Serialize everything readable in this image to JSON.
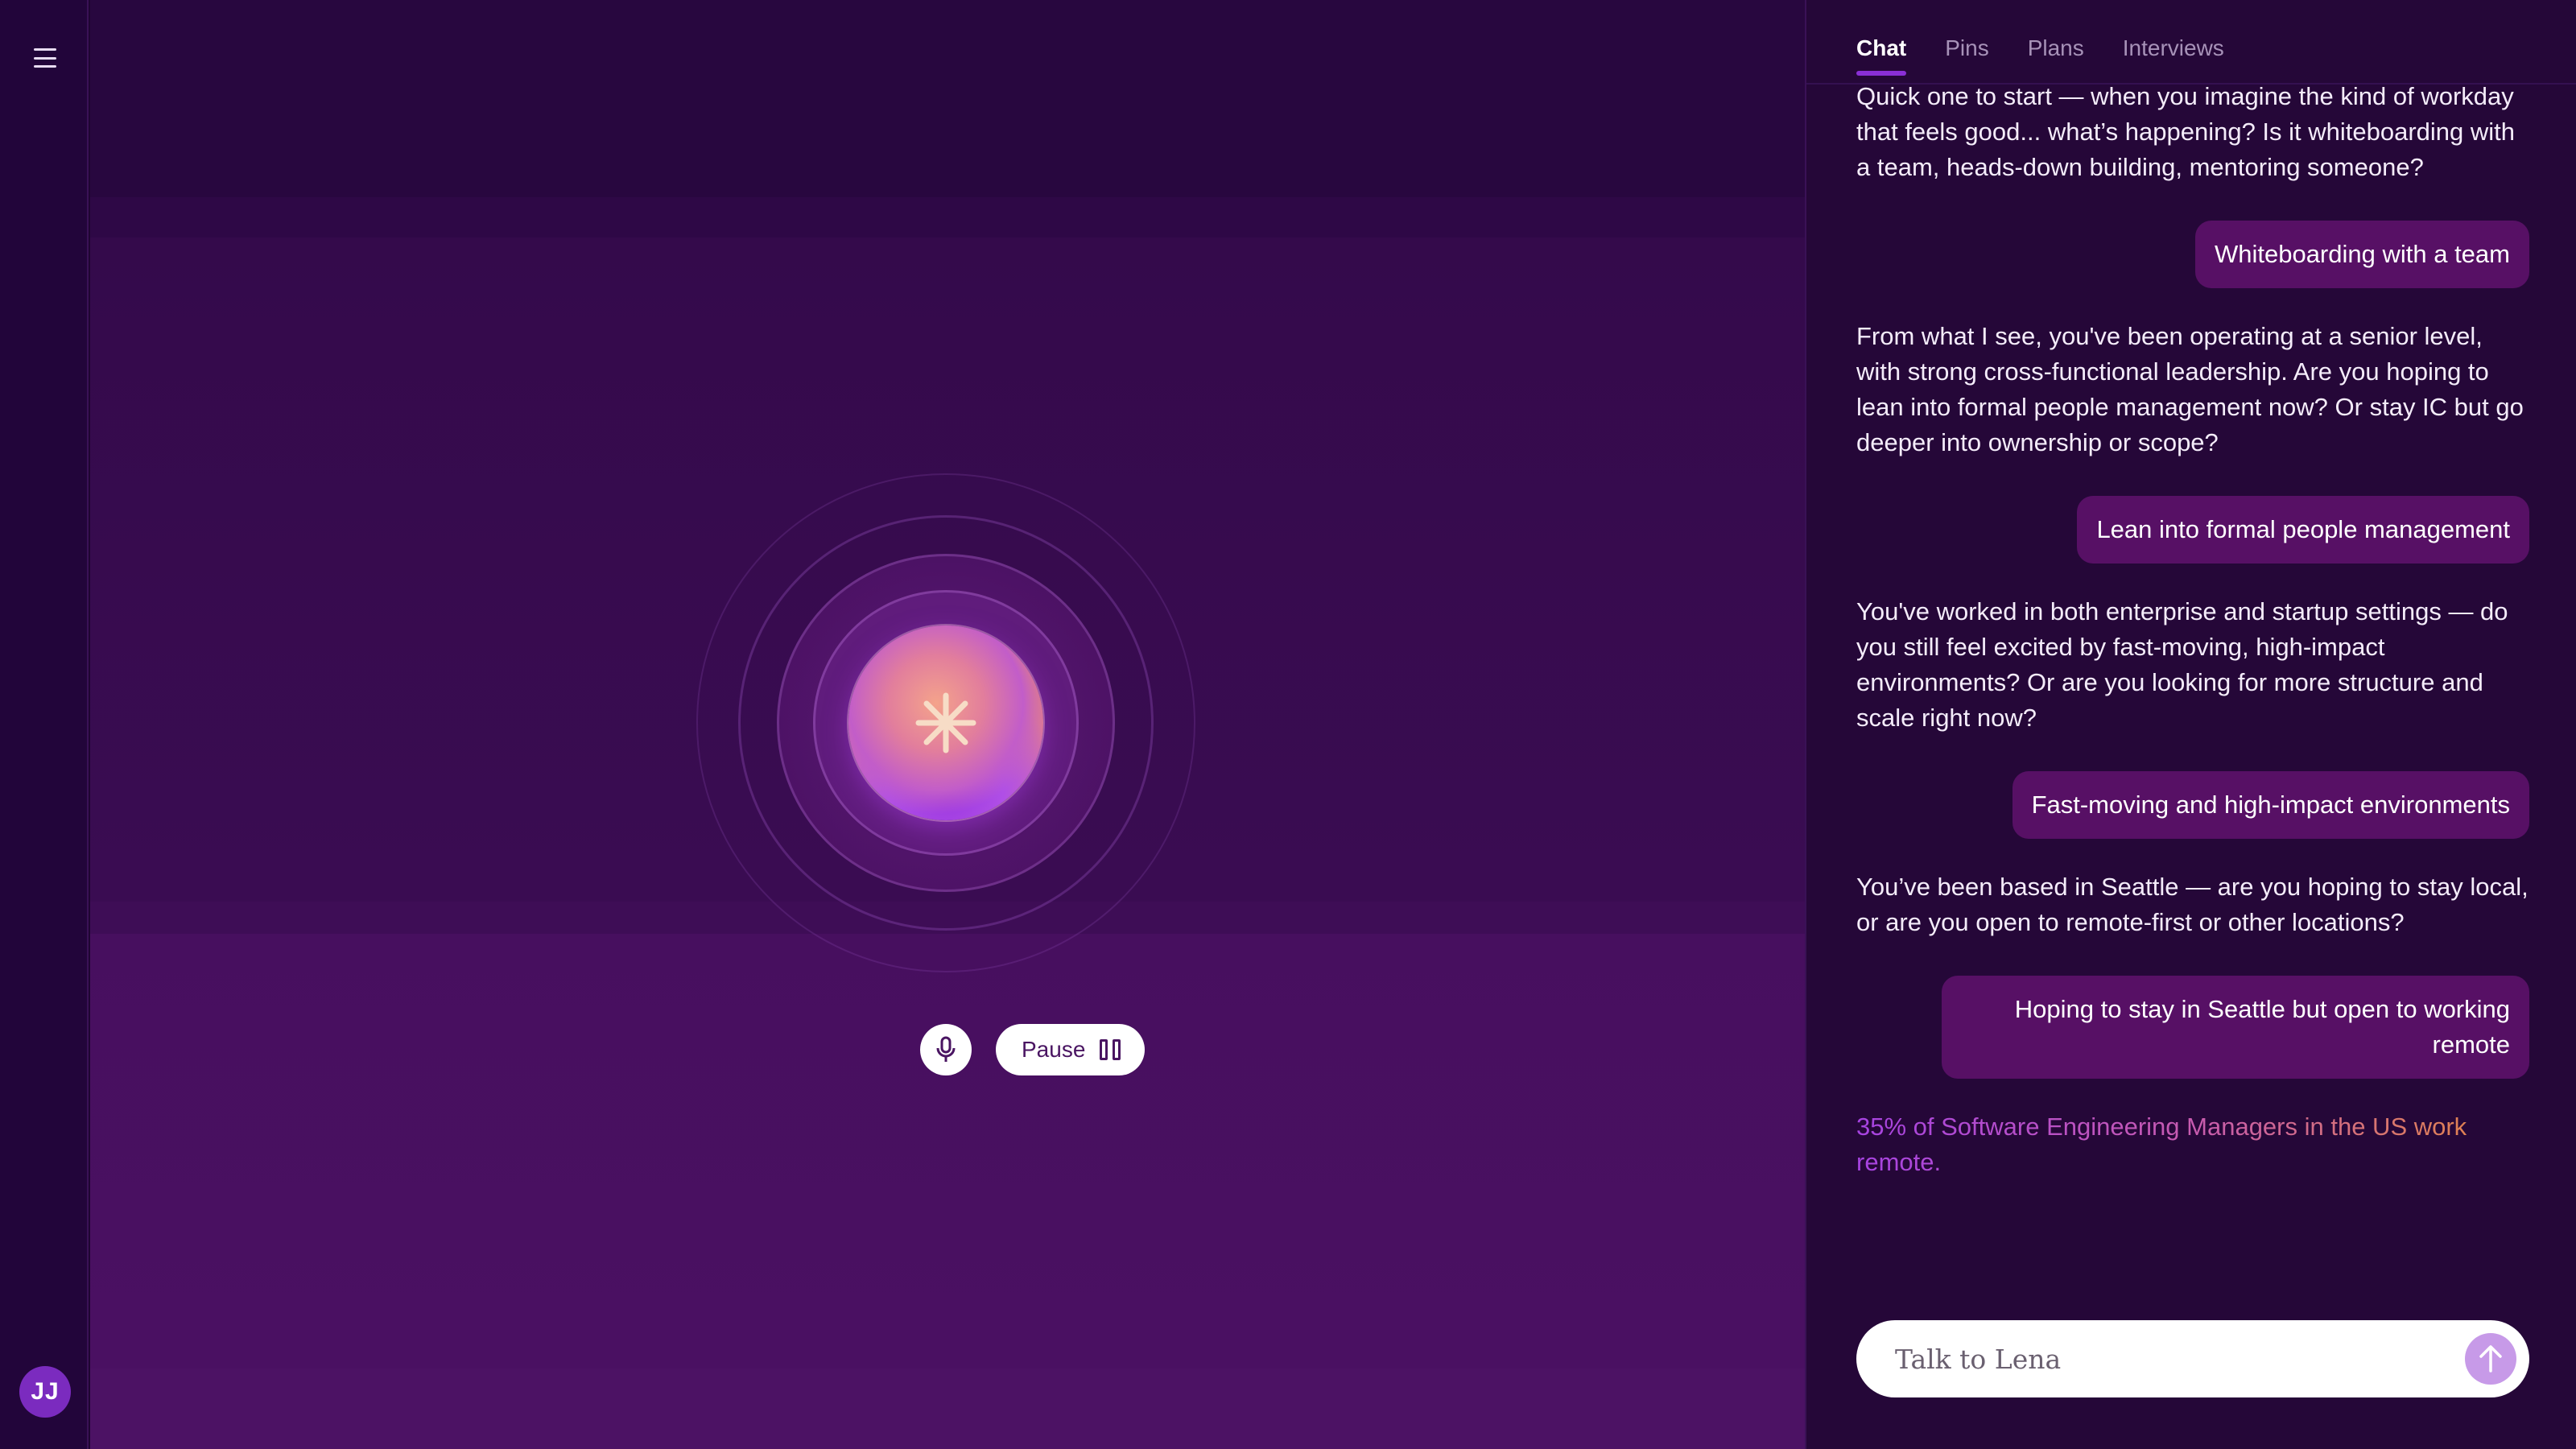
{
  "nav": {
    "menu_icon": "hamburger-menu-icon",
    "avatar_initials": "JJ"
  },
  "controls": {
    "pause_label": "Pause",
    "mic_icon": "microphone-icon",
    "pause_icon": "pause-icon"
  },
  "tabs": [
    {
      "label": "Chat",
      "active": true
    },
    {
      "label": "Pins",
      "active": false
    },
    {
      "label": "Plans",
      "active": false
    },
    {
      "label": "Interviews",
      "active": false
    }
  ],
  "messages": {
    "bot1": "Quick one to start — when you imagine the kind of workday that feels good... what’s happening? Is it whiteboarding with a team, heads-down building, mentoring someone?",
    "user1": "Whiteboarding with a team",
    "bot2": "From what I see, you've been operating at a senior level, with strong cross-functional leadership. Are you hoping to lean into formal people management now? Or stay IC but go deeper into ownership or scope?",
    "user2": "Lean into formal people management",
    "bot3": "You've worked in both enterprise and startup settings — do you still feel excited by fast-moving, high-impact environments? Or are you looking for more structure and scale right now?",
    "user3": "Fast-moving and high-impact environments",
    "bot4": "You’ve been based in Seattle — are you hoping to stay local, or are you open to remote-first or other locations?",
    "user4": "Hoping to stay in Seattle but open to working remote",
    "stat": "35% of Software Engineering Managers in the US work remote."
  },
  "input": {
    "placeholder": "Talk to Lena",
    "send_icon": "arrow-up-icon"
  },
  "colors": {
    "accent": "#8a2fd6",
    "user_bubble": "#571065",
    "send_button": "#c79ae8"
  }
}
